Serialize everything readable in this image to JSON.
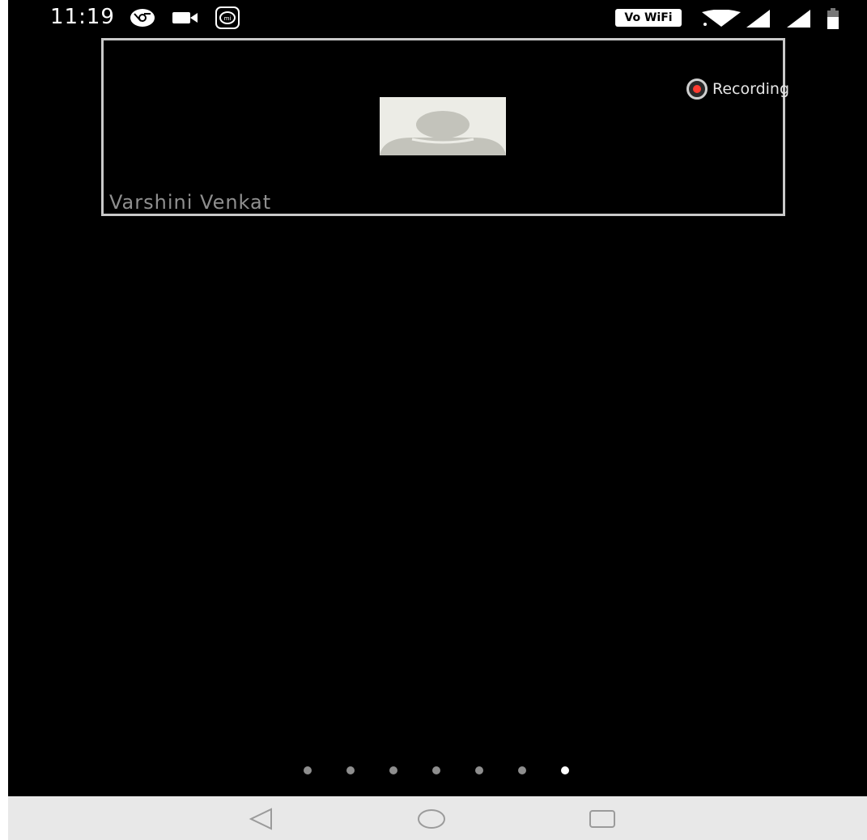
{
  "status_bar": {
    "time": "11:19",
    "icons": [
      "chrome-icon",
      "video-camera-icon",
      "mi-icon"
    ],
    "vowifi_label": "Vo WiFi",
    "right_icons": [
      "wifi-icon",
      "signal-icon",
      "signal-icon",
      "battery-icon"
    ]
  },
  "meeting": {
    "participant_name": "Varshini Venkat",
    "recording_label": "Recording",
    "recording_color": "#ff3b30"
  },
  "pager": {
    "total_pages": 7,
    "current_page": 7
  },
  "navigation": {
    "buttons": [
      "back-icon",
      "home-icon",
      "recents-icon"
    ]
  }
}
